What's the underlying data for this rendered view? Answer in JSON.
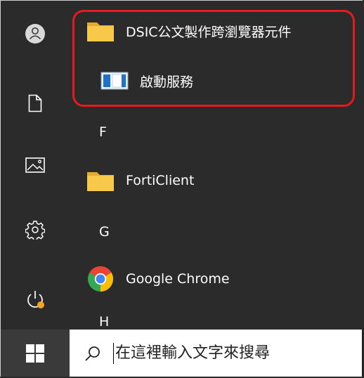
{
  "start_menu": {
    "apps": [
      {
        "label": "DSIC公文製作跨瀏覽器元件",
        "icon": "folder-icon"
      },
      {
        "label": "啟動服務",
        "icon": "service-window-icon"
      },
      {
        "label": "FortiClient",
        "icon": "folder-icon"
      },
      {
        "label": "Google Chrome",
        "icon": "chrome-icon"
      }
    ],
    "letters": [
      "F",
      "G",
      "H"
    ]
  },
  "rail": [
    "user-icon",
    "document-icon",
    "pictures-icon",
    "settings-icon",
    "power-icon"
  ],
  "taskbar": {
    "search_placeholder": "在這裡輸入文字來搜尋"
  },
  "colors": {
    "highlight": "#e8191d",
    "menu_background": "#2b2b2b",
    "folder": "#f5c33b"
  }
}
